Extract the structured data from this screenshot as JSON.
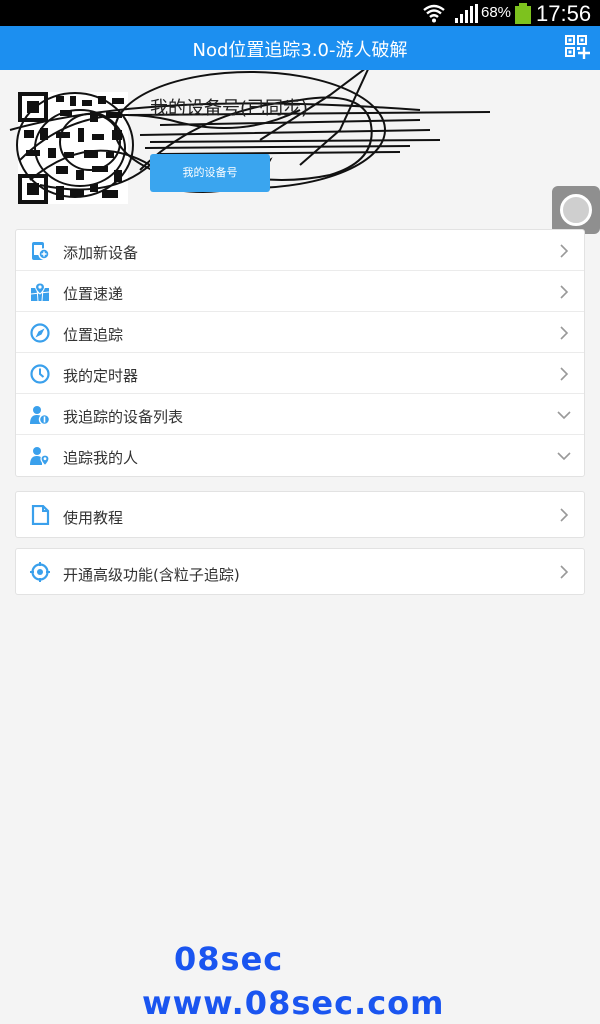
{
  "status_bar": {
    "battery": "68%",
    "time": "17:56"
  },
  "app_bar": {
    "title": "Nod位置追踪3.0-游人破解"
  },
  "header": {
    "device_label": "我的设备号(已同步)",
    "button_label": "我的设备号"
  },
  "menu_main": [
    {
      "label": "添加新设备",
      "icon": "add-device-icon",
      "chevron": "right"
    },
    {
      "label": "位置速递",
      "icon": "map-pin-icon",
      "chevron": "right"
    },
    {
      "label": "位置追踪",
      "icon": "navigation-icon",
      "chevron": "right"
    },
    {
      "label": "我的定时器",
      "icon": "clock-icon",
      "chevron": "right"
    },
    {
      "label": "我追踪的设备列表",
      "icon": "user-tracked-icon",
      "chevron": "down"
    },
    {
      "label": "追踪我的人",
      "icon": "user-location-icon",
      "chevron": "down"
    }
  ],
  "menu_tutorial": {
    "label": "使用教程",
    "icon": "document-icon"
  },
  "menu_premium": {
    "label": "开通高级功能(含粒子追踪)",
    "icon": "target-icon"
  },
  "watermark": {
    "line1": "08sec",
    "line2": "www.08sec.com"
  },
  "colors": {
    "primary": "#1c8ff0",
    "icon": "#3aa0ec",
    "watermark": "#1a55f0"
  }
}
